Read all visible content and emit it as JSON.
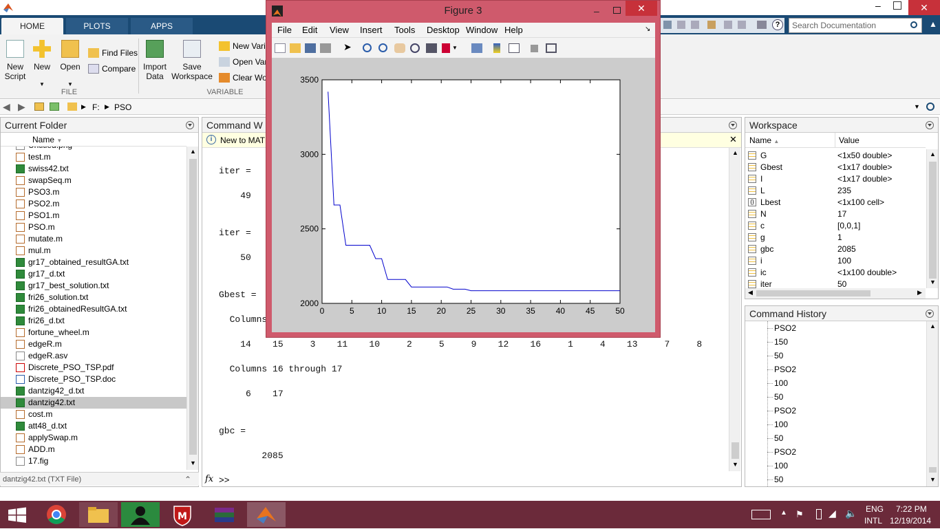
{
  "app": {
    "name": "MATLAB"
  },
  "tabs": [
    {
      "label": "HOME"
    },
    {
      "label": "PLOTS"
    },
    {
      "label": "APPS"
    }
  ],
  "ribbon": {
    "file": {
      "new_script": "New\nScript",
      "new": "New",
      "open": "Open",
      "find_files": "Find Files",
      "compare": "Compare",
      "group_label": "FILE"
    },
    "variable": {
      "import_data": "Import\nData",
      "save_workspace": "Save\nWorkspace",
      "new_variable": "New Varia",
      "open_variable": "Open Vari",
      "clear_workspace": "Clear Wor",
      "group_label": "VARIABLE"
    }
  },
  "search": {
    "placeholder": "Search Documentation"
  },
  "address": {
    "drive": "F:",
    "folder": "PSO"
  },
  "current_folder": {
    "title": "Current Folder",
    "column": "Name",
    "files": [
      {
        "name": "Untitled.png",
        "type": "png"
      },
      {
        "name": "test.m",
        "type": "m"
      },
      {
        "name": "swiss42.txt",
        "type": "txt"
      },
      {
        "name": "swapSeq.m",
        "type": "m"
      },
      {
        "name": "PSO3.m",
        "type": "m"
      },
      {
        "name": "PSO2.m",
        "type": "m"
      },
      {
        "name": "PSO1.m",
        "type": "m"
      },
      {
        "name": "PSO.m",
        "type": "m"
      },
      {
        "name": "mutate.m",
        "type": "m"
      },
      {
        "name": "mul.m",
        "type": "m"
      },
      {
        "name": "gr17_obtained_resultGA.txt",
        "type": "txt"
      },
      {
        "name": "gr17_d.txt",
        "type": "txt"
      },
      {
        "name": "gr17_best_solution.txt",
        "type": "txt"
      },
      {
        "name": "fri26_solution.txt",
        "type": "txt"
      },
      {
        "name": "fri26_obtainedResultGA.txt",
        "type": "txt"
      },
      {
        "name": "fri26_d.txt",
        "type": "txt"
      },
      {
        "name": "fortune_wheel.m",
        "type": "m"
      },
      {
        "name": "edgeR.m",
        "type": "m"
      },
      {
        "name": "edgeR.asv",
        "type": "asv"
      },
      {
        "name": "Discrete_PSO_TSP.pdf",
        "type": "pdf"
      },
      {
        "name": "Discrete_PSO_TSP.doc",
        "type": "doc"
      },
      {
        "name": "dantzig42_d.txt",
        "type": "txt"
      },
      {
        "name": "dantzig42.txt",
        "type": "txt",
        "selected": true
      },
      {
        "name": "cost.m",
        "type": "m"
      },
      {
        "name": "att48_d.txt",
        "type": "txt"
      },
      {
        "name": "applySwap.m",
        "type": "m"
      },
      {
        "name": "ADD.m",
        "type": "m"
      },
      {
        "name": "17.fig",
        "type": "fig"
      }
    ],
    "status": "dantzig42.txt (TXT File)"
  },
  "command_window": {
    "title": "Command W",
    "banner": "New to MAT",
    "prompt": ">>",
    "fx": "fx",
    "lines": [
      {
        "text": "iter =",
        "top": 70
      },
      {
        "text": "    49",
        "top": 106
      },
      {
        "text": "iter =",
        "top": 160
      },
      {
        "text": "    50",
        "top": 196
      },
      {
        "text": "Gbest =",
        "top": 250
      },
      {
        "text": "  Columns",
        "top": 286
      },
      {
        "text": "    14    15     3    11    10     2     5     9    12    16     1     4    13     7     8",
        "top": 322
      },
      {
        "text": "  Columns 16 through 17",
        "top": 358
      },
      {
        "text": "     6    17",
        "top": 394
      },
      {
        "text": "gbc =",
        "top": 448
      },
      {
        "text": "        2085",
        "top": 484
      }
    ]
  },
  "workspace": {
    "title": "Workspace",
    "col_name": "Name",
    "col_value": "Value",
    "vars": [
      {
        "name": "G",
        "value": "<1x50 double>"
      },
      {
        "name": "Gbest",
        "value": "<1x17 double>"
      },
      {
        "name": "I",
        "value": "<1x17 double>"
      },
      {
        "name": "L",
        "value": "235"
      },
      {
        "name": "Lbest",
        "value": "<1x100 cell>"
      },
      {
        "name": "N",
        "value": "17"
      },
      {
        "name": "c",
        "value": "[0,0,1]"
      },
      {
        "name": "g",
        "value": "1"
      },
      {
        "name": "gbc",
        "value": "2085"
      },
      {
        "name": "i",
        "value": "100"
      },
      {
        "name": "ic",
        "value": "<1x100 double>"
      },
      {
        "name": "iter",
        "value": "50"
      }
    ]
  },
  "command_history": {
    "title": "Command History",
    "items": [
      "PSO2",
      "150",
      "50",
      "PSO2",
      "100",
      "50",
      "PSO2",
      "100",
      "50",
      "PSO2",
      "100",
      "50"
    ]
  },
  "figure": {
    "title": "Figure 3",
    "menu": [
      "File",
      "Edit",
      "View",
      "Insert",
      "Tools",
      "Desktop",
      "Window",
      "Help"
    ]
  },
  "chart_data": {
    "type": "line",
    "title": "",
    "xlabel": "",
    "ylabel": "",
    "xlim": [
      0,
      50
    ],
    "ylim": [
      2000,
      3500
    ],
    "xticks": [
      0,
      5,
      10,
      15,
      20,
      25,
      30,
      35,
      40,
      45,
      50
    ],
    "yticks": [
      2000,
      2500,
      3000,
      3500
    ],
    "color": "#0000cc",
    "x": [
      1,
      2,
      3,
      4,
      5,
      6,
      7,
      8,
      9,
      10,
      11,
      12,
      13,
      14,
      15,
      16,
      17,
      18,
      19,
      20,
      21,
      22,
      23,
      24,
      25,
      26,
      27,
      28,
      29,
      30,
      31,
      32,
      33,
      34,
      35,
      36,
      37,
      38,
      39,
      40,
      41,
      42,
      43,
      44,
      45,
      46,
      47,
      48,
      49,
      50
    ],
    "y": [
      3420,
      2660,
      2660,
      2390,
      2390,
      2390,
      2390,
      2390,
      2300,
      2300,
      2160,
      2160,
      2160,
      2160,
      2110,
      2110,
      2110,
      2110,
      2110,
      2110,
      2110,
      2095,
      2095,
      2095,
      2085,
      2085,
      2085,
      2085,
      2085,
      2085,
      2085,
      2085,
      2085,
      2085,
      2085,
      2085,
      2085,
      2085,
      2085,
      2085,
      2085,
      2085,
      2085,
      2085,
      2085,
      2085,
      2085,
      2085,
      2085,
      2085
    ]
  },
  "taskbar": {
    "lang1": "ENG",
    "lang2": "INTL",
    "time": "7:22 PM",
    "date": "12/19/2014"
  }
}
